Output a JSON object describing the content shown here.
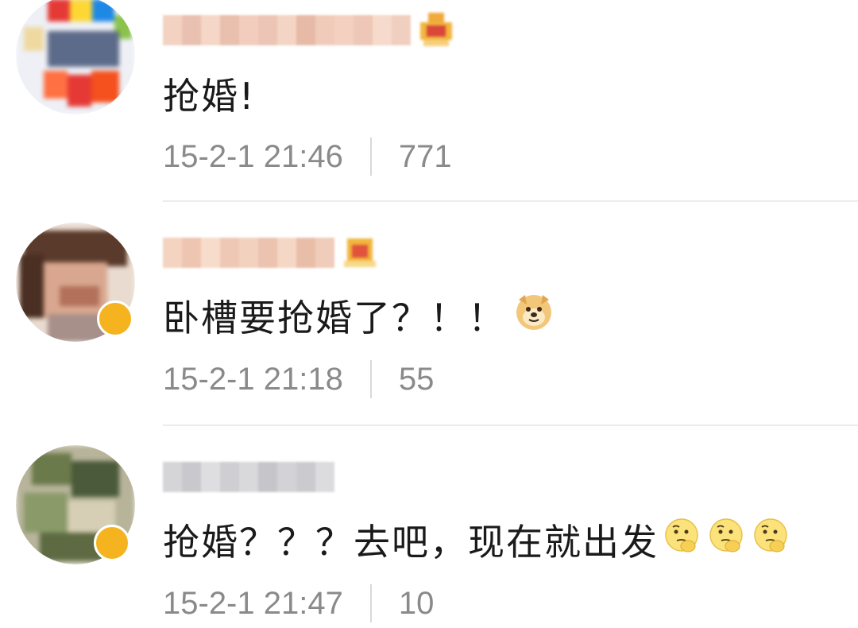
{
  "comments": [
    {
      "text": "抢婚!",
      "time": "15-2-1 21:46",
      "likes": "771",
      "emoji": []
    },
    {
      "text": "卧槽要抢婚了？！！",
      "time": "15-2-1 21:18",
      "likes": "55",
      "emoji": [
        "doge-emoji"
      ]
    },
    {
      "text": "抢婚？？？去吧，现在就出发",
      "time": "15-2-1 21:47",
      "likes": "10",
      "emoji": [
        "thinking-emoji",
        "thinking-emoji",
        "thinking-emoji"
      ]
    }
  ],
  "colors": {
    "text": "#1a1a1a",
    "meta": "#8a8a8a",
    "divider": "#ececec",
    "verify_badge": "#f5b41f"
  }
}
